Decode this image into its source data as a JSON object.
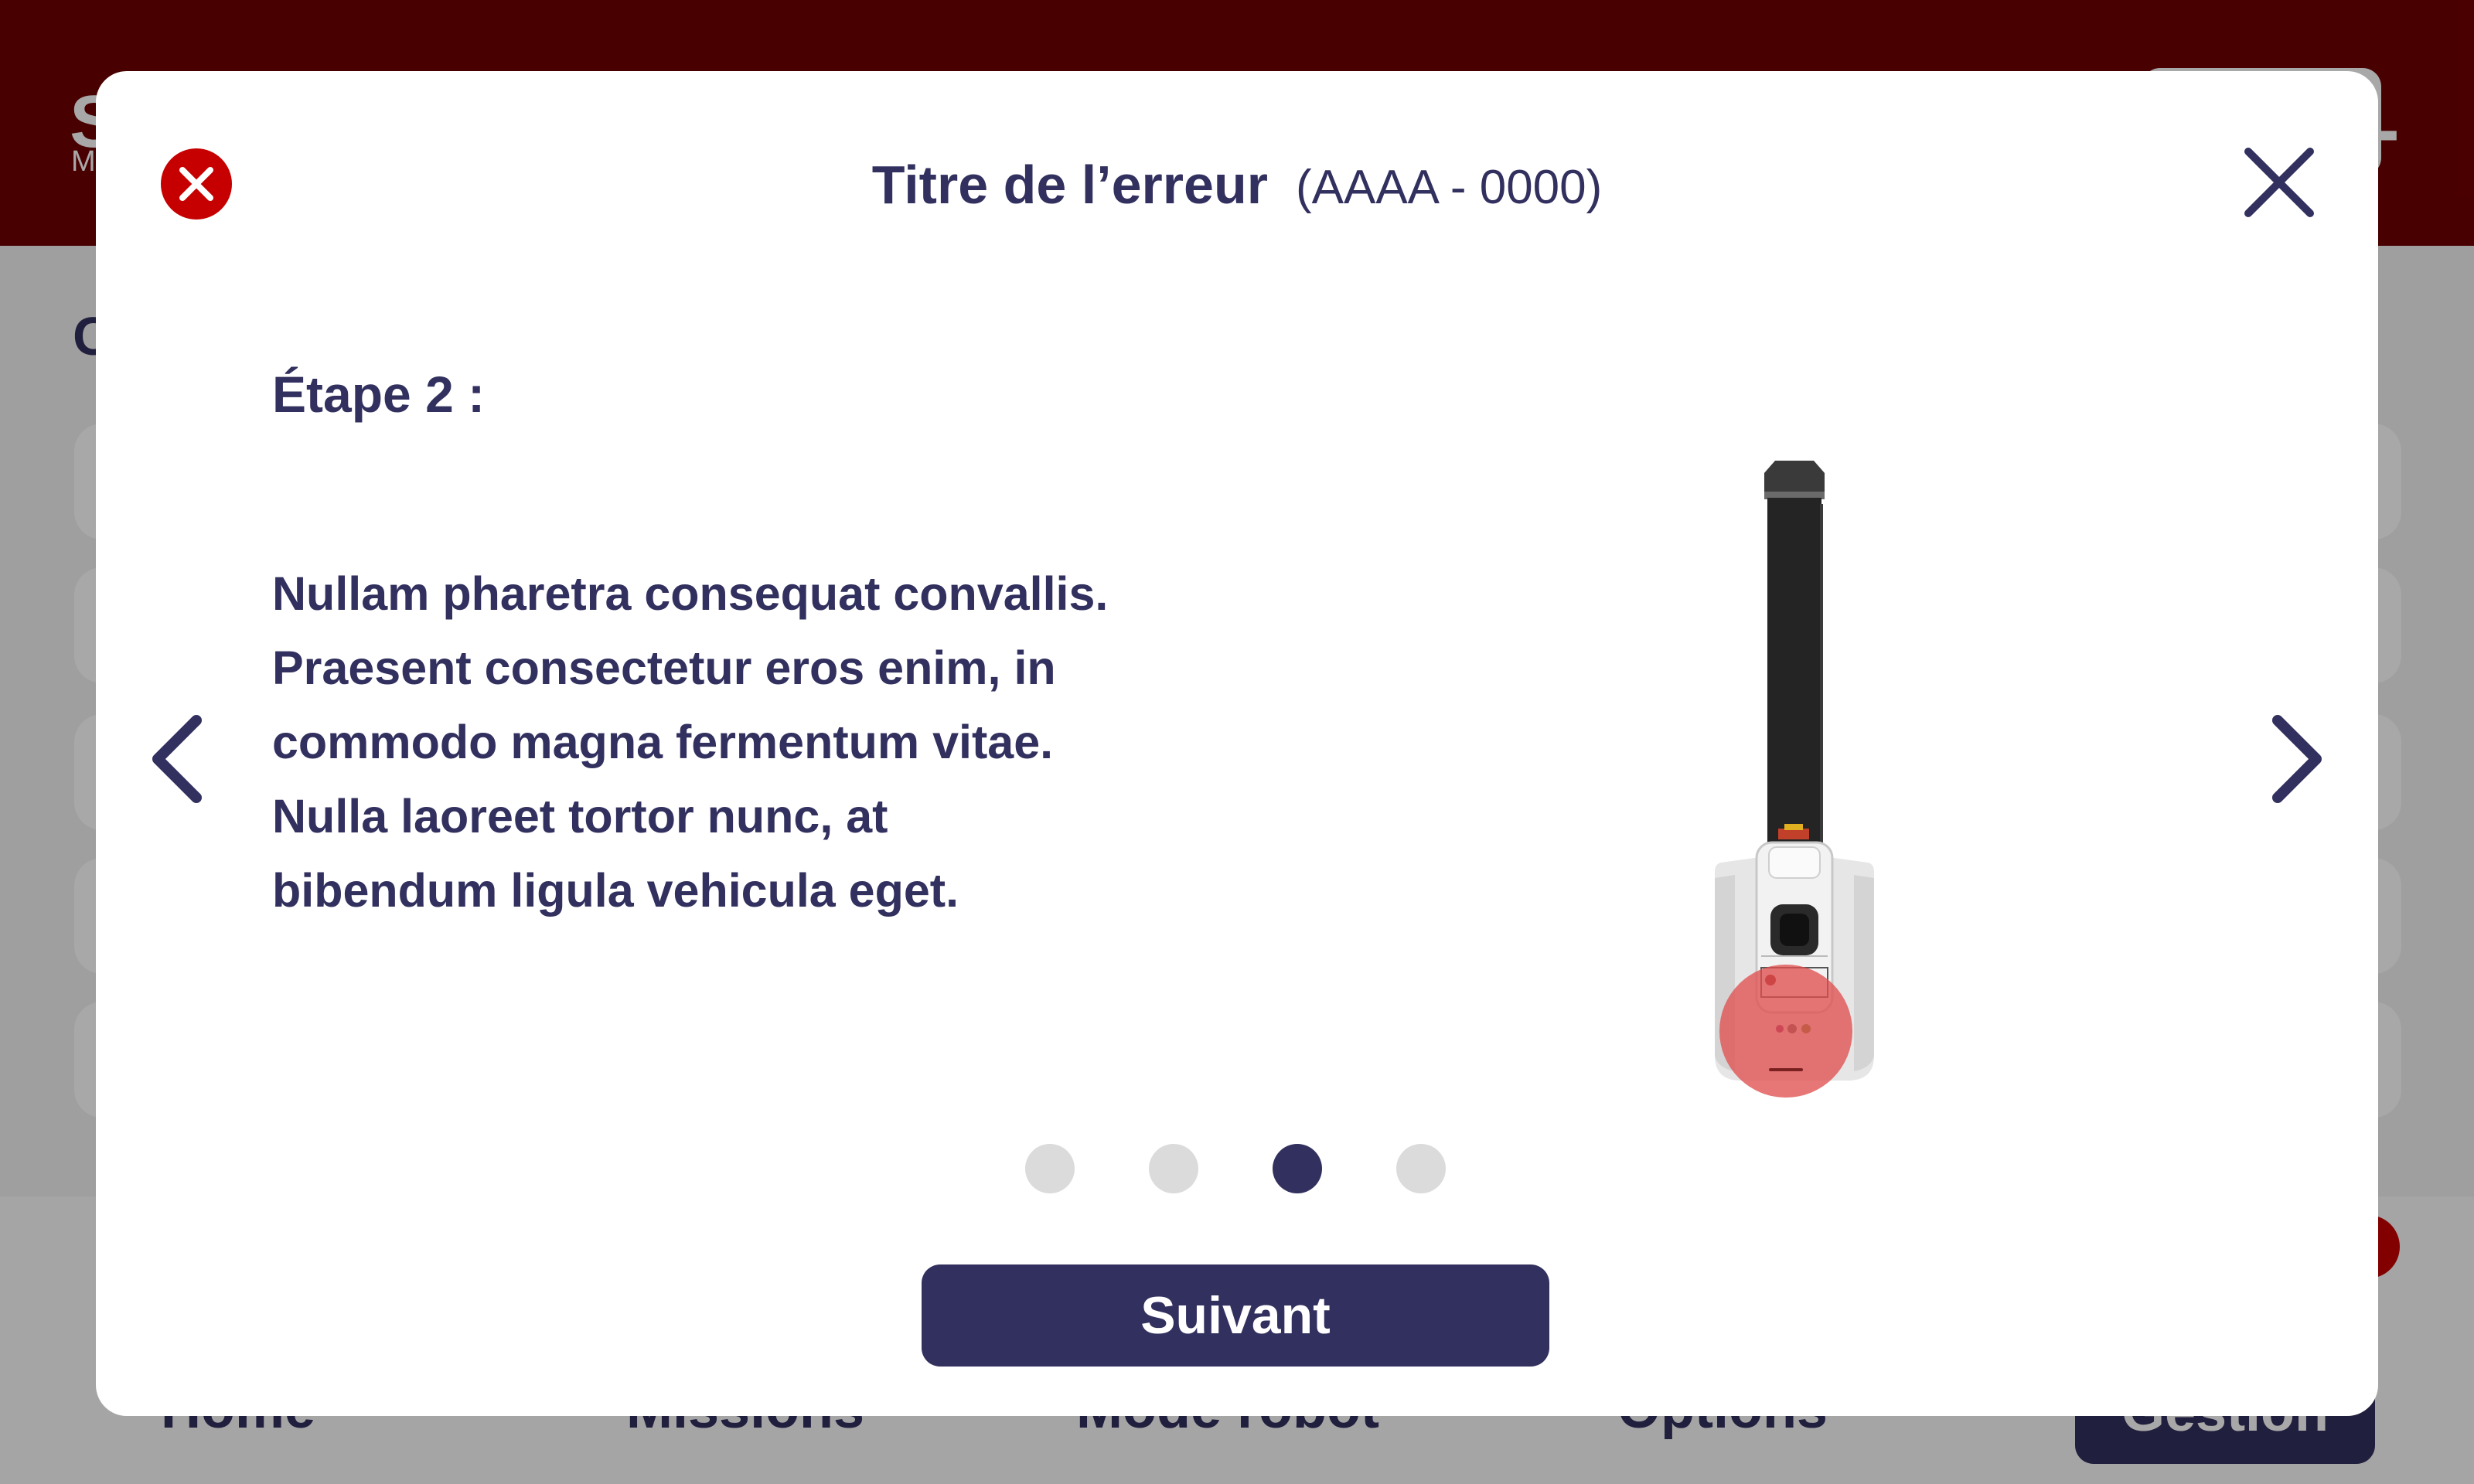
{
  "app": {
    "logo_big": "S",
    "logo_small": "M",
    "page_heading": "C",
    "nav": {
      "home": "Home",
      "missions": "Missions",
      "mode_robot": "Mode robot",
      "options": "Options",
      "gestion": "Gestion"
    }
  },
  "modal": {
    "title": "Titre de l’erreur",
    "code": "(AAAA - 0000)",
    "step_label": "Étape 2 :",
    "body_lines": [
      "Nullam pharetra consequat convallis.",
      "Praesent consectetur eros enim, in",
      "commodo magna fermentum vitae.",
      "Nulla laoreet tortor nunc, at",
      "bibendum ligula vehicula eget."
    ],
    "next_label": "Suivant",
    "pagination": {
      "total": 4,
      "current": 3
    },
    "icons": {
      "error": "error-circle-icon",
      "close": "close-icon",
      "prev": "chevron-left-icon",
      "next": "chevron-right-icon"
    }
  },
  "colors": {
    "topbar": "#700000",
    "primary": "#32305e",
    "error": "#c60000",
    "dot_inactive": "#dbdbdb",
    "highlight": "#e05050"
  }
}
